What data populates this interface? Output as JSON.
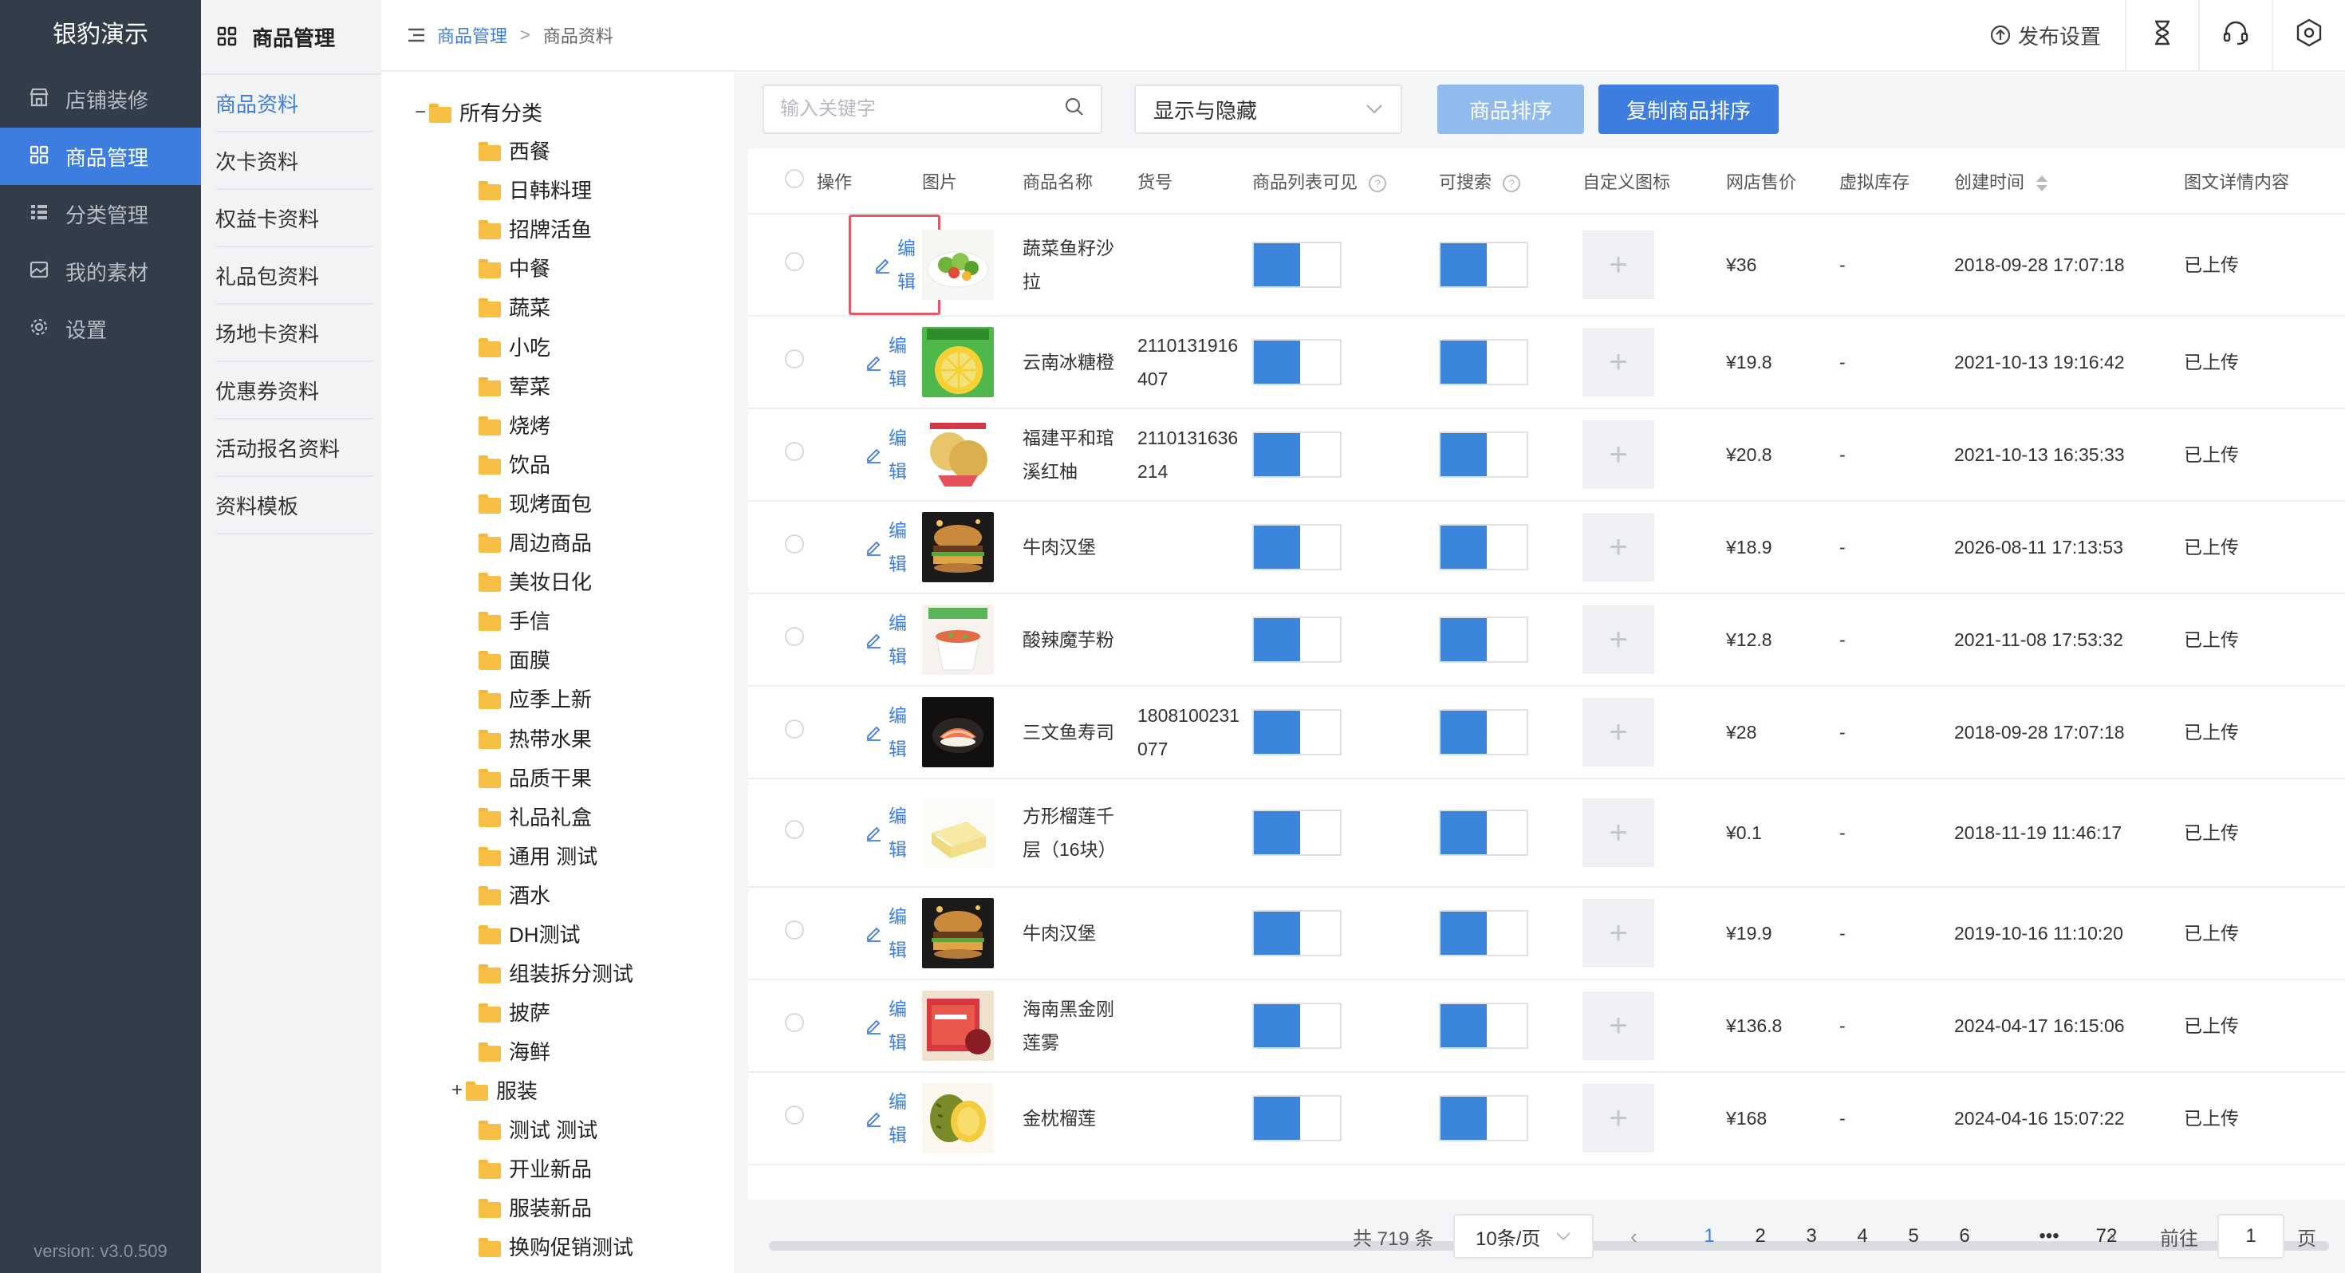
{
  "nav": {
    "brand": "银豹演示",
    "items": [
      {
        "label": "店铺装修",
        "icon": "store-icon"
      },
      {
        "label": "商品管理",
        "icon": "grid-icon",
        "active": true
      },
      {
        "label": "分类管理",
        "icon": "list-icon"
      },
      {
        "label": "我的素材",
        "icon": "image-icon"
      },
      {
        "label": "设置",
        "icon": "gear-icon"
      }
    ],
    "version": "version: v3.0.509"
  },
  "submenu": {
    "title": "商品管理",
    "items": [
      "商品资料",
      "次卡资料",
      "权益卡资料",
      "礼品包资料",
      "场地卡资料",
      "优惠券资料",
      "活动报名资料",
      "资料模板"
    ]
  },
  "header": {
    "breadcrumb": [
      "商品管理",
      "商品资料"
    ],
    "breadcrumb_sep": ">",
    "publish_label": "发布设置"
  },
  "tree": {
    "root": "所有分类",
    "root_toggle": "−",
    "categories": [
      "西餐",
      "日韩料理",
      "招牌活鱼",
      "中餐",
      "蔬菜",
      "小吃",
      "荤菜",
      "烧烤",
      "饮品",
      "现烤面包",
      "周边商品",
      "美妆日化",
      "手信",
      "面膜",
      "应季上新",
      "热带水果",
      "品质干果",
      "礼品礼盒",
      "通用 测试",
      "酒水",
      "DH测试",
      "组装拆分测试",
      "披萨",
      "海鲜"
    ],
    "expandable": {
      "label": "服装",
      "toggle": "+"
    },
    "children": [
      "测试 测试",
      "开业新品",
      "服装新品",
      "换购促销测试"
    ]
  },
  "toolbar": {
    "search_placeholder": "输入关键字",
    "select_value": "显示与隐藏",
    "sort_button": "商品排序",
    "copy_button": "复制商品排序"
  },
  "table": {
    "headers": [
      "操作",
      "图片",
      "商品名称",
      "货号",
      "商品列表可见",
      "可搜索",
      "自定义图标",
      "网店售价",
      "虚拟库存",
      "创建时间",
      "图文详情内容"
    ],
    "edit_label": "编辑",
    "add_icon": "+",
    "help_mark": "?",
    "rows": [
      {
        "name": "蔬菜鱼籽沙拉",
        "sku": "",
        "price": "¥36",
        "stock": "-",
        "created": "2018-09-28 17:07:18",
        "detail": "已上传",
        "img": "salad",
        "visible": true,
        "searchable": true
      },
      {
        "name": "云南冰糖橙",
        "sku": "2110131916407",
        "price": "¥19.8",
        "stock": "-",
        "created": "2021-10-13 19:16:42",
        "detail": "已上传",
        "img": "orange",
        "visible": true,
        "searchable": true
      },
      {
        "name": "福建平和琯溪红柚",
        "sku": "2110131636214",
        "price": "¥20.8",
        "stock": "-",
        "created": "2021-10-13 16:35:33",
        "detail": "已上传",
        "img": "pomelo",
        "visible": true,
        "searchable": true
      },
      {
        "name": "牛肉汉堡",
        "sku": "",
        "price": "¥18.9",
        "stock": "-",
        "created": "2026-08-11 17:13:53",
        "detail": "已上传",
        "img": "burger",
        "visible": true,
        "searchable": true
      },
      {
        "name": "酸辣魔芋粉",
        "sku": "",
        "price": "¥12.8",
        "stock": "-",
        "created": "2021-11-08 17:53:32",
        "detail": "已上传",
        "img": "noodle",
        "visible": true,
        "searchable": true
      },
      {
        "name": "三文鱼寿司",
        "sku": "1808100231077",
        "price": "¥28",
        "stock": "-",
        "created": "2018-09-28 17:07:18",
        "detail": "已上传",
        "img": "sushi",
        "visible": true,
        "searchable": true
      },
      {
        "name": "方形榴莲千层（16块）",
        "sku": "",
        "price": "¥0.1",
        "stock": "-",
        "created": "2018-11-19 11:46:17",
        "detail": "已上传",
        "img": "cake",
        "visible": true,
        "searchable": true
      },
      {
        "name": "牛肉汉堡",
        "sku": "",
        "price": "¥19.9",
        "stock": "-",
        "created": "2019-10-16 11:10:20",
        "detail": "已上传",
        "img": "burger",
        "visible": true,
        "searchable": true
      },
      {
        "name": "海南黑金刚莲雾",
        "sku": "",
        "price": "¥136.8",
        "stock": "-",
        "created": "2024-04-17 16:15:06",
        "detail": "已上传",
        "img": "wax",
        "visible": true,
        "searchable": true
      },
      {
        "name": "金枕榴莲",
        "sku": "",
        "price": "¥168",
        "stock": "-",
        "created": "2024-04-16 15:07:22",
        "detail": "已上传",
        "img": "durian",
        "visible": true,
        "searchable": true
      }
    ]
  },
  "pagination": {
    "total": "共 719 条",
    "page_size": "10条/页",
    "pages": [
      "1",
      "2",
      "3",
      "4",
      "5",
      "6",
      "•••",
      "72"
    ],
    "current": "1",
    "prev": "‹",
    "next": "›",
    "goto_label": "前往",
    "goto_value": "1",
    "goto_unit": "页"
  },
  "colors": {
    "nav_bg": "#333c49",
    "accent": "#3d7de0",
    "highlight_border": "#e05a68",
    "switch_on": "#3b86db"
  }
}
